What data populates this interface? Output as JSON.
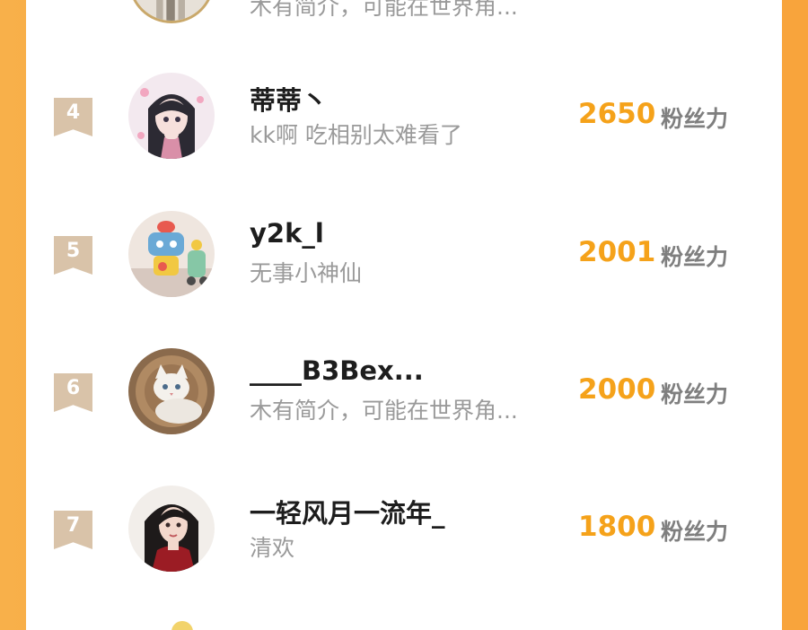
{
  "colors": {
    "accent": "#f5a21a",
    "background": "#f9a23a",
    "rank_badge": "#d9c3a9",
    "name": "#1d1d1d",
    "bio": "#9a9a9a",
    "unit": "#7f7f7f"
  },
  "top_partial": {
    "bio": "木有简介，可能在世界角..."
  },
  "ranking": [
    {
      "rank": "4",
      "name": "蒂蒂丶",
      "bio": "kk啊 吃相别太难看了",
      "score": "2650",
      "unit": "粉丝力",
      "avatar_icon": "anime-girl-avatar"
    },
    {
      "rank": "5",
      "name": "y2k_l",
      "bio": "无事小神仙",
      "score": "2001",
      "unit": "粉丝力",
      "avatar_icon": "toy-robot-avatar"
    },
    {
      "rank": "6",
      "name": "____B3Bex...",
      "bio": "木有简介，可能在世界角...",
      "score": "2000",
      "unit": "粉丝力",
      "avatar_icon": "kitten-avatar"
    },
    {
      "rank": "7",
      "name": "一轻风月一流年_",
      "bio": "清欢",
      "score": "1800",
      "unit": "粉丝力",
      "avatar_icon": "woman-portrait-avatar"
    }
  ]
}
